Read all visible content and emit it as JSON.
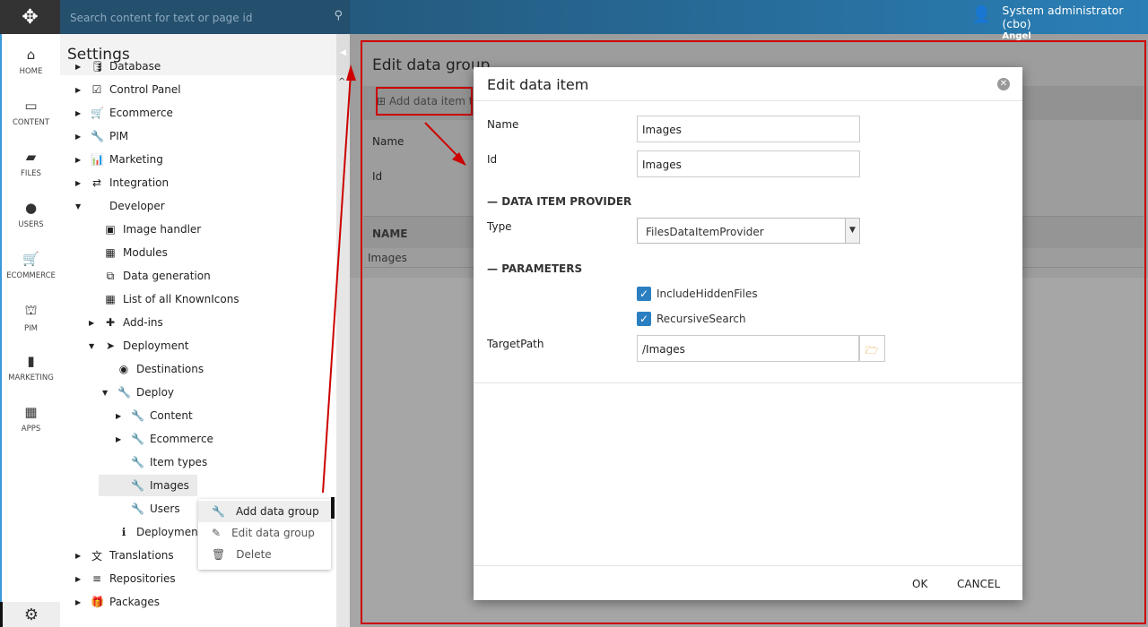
{
  "topbar": {
    "search_placeholder": "Search content for text or page id",
    "user_name": "System administrator (cbo)",
    "user_sub": "Angel"
  },
  "leftnav": [
    {
      "icon": "home-icon",
      "label": "HOME"
    },
    {
      "icon": "monitor-icon",
      "label": "CONTENT"
    },
    {
      "icon": "briefcase-icon",
      "label": "FILES"
    },
    {
      "icon": "user-icon",
      "label": "USERS"
    },
    {
      "icon": "cart-icon",
      "label": "ECOMMERCE"
    },
    {
      "icon": "basket-icon",
      "label": "PIM"
    },
    {
      "icon": "bar-chart-icon",
      "label": "MARKETING"
    },
    {
      "icon": "grid-icon",
      "label": "APPS"
    }
  ],
  "panel": {
    "title": "Settings"
  },
  "tree": [
    {
      "label": "Database",
      "level": 0,
      "arrow": "right"
    },
    {
      "label": "Control Panel",
      "level": 0,
      "arrow": "right"
    },
    {
      "label": "Ecommerce",
      "level": 0,
      "arrow": "right"
    },
    {
      "label": "PIM",
      "level": 0,
      "arrow": "right"
    },
    {
      "label": "Marketing",
      "level": 0,
      "arrow": "right"
    },
    {
      "label": "Integration",
      "level": 0,
      "arrow": "right"
    },
    {
      "label": "Developer",
      "level": 0,
      "arrow": "down"
    },
    {
      "label": "Image handler",
      "level": 1,
      "arrow": ""
    },
    {
      "label": "Modules",
      "level": 1,
      "arrow": ""
    },
    {
      "label": "Data generation",
      "level": 1,
      "arrow": ""
    },
    {
      "label": "List of all KnownIcons",
      "level": 1,
      "arrow": ""
    },
    {
      "label": "Add-ins",
      "level": 1,
      "arrow": "right"
    },
    {
      "label": "Deployment",
      "level": 1,
      "arrow": "down"
    },
    {
      "label": "Destinations",
      "level": 2,
      "arrow": ""
    },
    {
      "label": "Deploy",
      "level": 2,
      "arrow": "down"
    },
    {
      "label": "Content",
      "level": 3,
      "arrow": "right"
    },
    {
      "label": "Ecommerce",
      "level": 3,
      "arrow": "right"
    },
    {
      "label": "Item types",
      "level": 3,
      "arrow": ""
    },
    {
      "label": "Images",
      "level": 3,
      "arrow": "",
      "selected": true
    },
    {
      "label": "Users",
      "level": 3,
      "arrow": ""
    },
    {
      "label": "Deployment",
      "level": 2,
      "arrow": ""
    },
    {
      "label": "Translations",
      "level": 0,
      "arrow": "right"
    },
    {
      "label": "Repositories",
      "level": 0,
      "arrow": "right"
    },
    {
      "label": "Packages",
      "level": 0,
      "arrow": "right"
    }
  ],
  "context_menu": [
    {
      "label": "Add data group",
      "icon": "wrench-icon"
    },
    {
      "label": "Edit data group",
      "icon": "edit-icon"
    },
    {
      "label": "Delete",
      "icon": "trash-icon"
    }
  ],
  "background": {
    "title": "Edit data group",
    "add_button": "Add data item t",
    "name_label": "Name",
    "id_label": "Id",
    "column_name": "NAME",
    "row": "Images"
  },
  "modal": {
    "title": "Edit data item",
    "name_label": "Name",
    "name_value": "Images",
    "id_label": "Id",
    "id_value": "Images",
    "section_provider": "DATA ITEM PROVIDER",
    "type_label": "Type",
    "type_value": "FilesDataItemProvider",
    "section_parameters": "PARAMETERS",
    "cb1": "IncludeHiddenFiles",
    "cb2": "RecursiveSearch",
    "target_label": "TargetPath",
    "target_value": "/Images",
    "ok": "OK",
    "cancel": "CANCEL"
  },
  "colors": {
    "accent": "#2a7fc1",
    "annotation": "#cc0000"
  }
}
